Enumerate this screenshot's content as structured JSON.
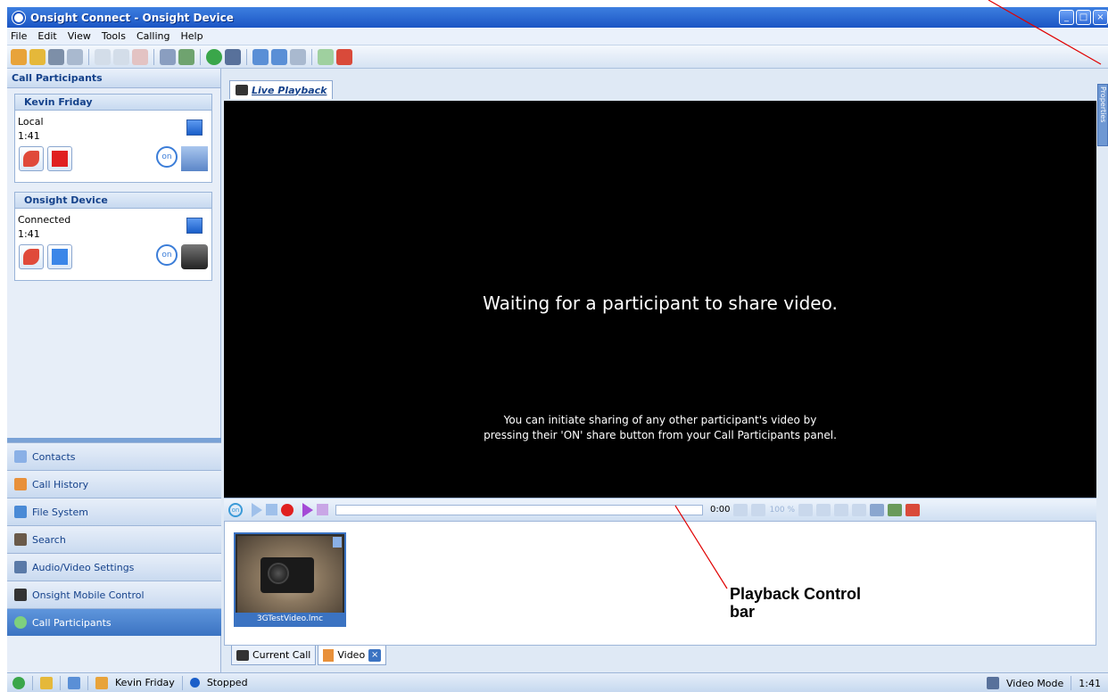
{
  "window": {
    "title": "Onsight Connect - Onsight Device"
  },
  "menu": [
    "File",
    "Edit",
    "View",
    "Tools",
    "Calling",
    "Help"
  ],
  "left_panel": {
    "header": "Call Participants",
    "participants": [
      {
        "name": "Kevin Friday",
        "status": "Local",
        "time": "1:41",
        "share": "on"
      },
      {
        "name": "Onsight Device",
        "status": "Connected",
        "time": "1:41",
        "share": "on"
      }
    ],
    "nav": [
      "Contacts",
      "Call History",
      "File System",
      "Search",
      "Audio/Video Settings",
      "Onsight Mobile Control",
      "Call Participants"
    ]
  },
  "main": {
    "tab": "Live Playback",
    "video_message": "Waiting for a participant to share video.",
    "video_sub_line1": "You can initiate sharing of any other participant's video by",
    "video_sub_line2": "pressing their 'ON' share button from your Call Participants panel.",
    "playback": {
      "time": "0:00",
      "zoom": "100 %",
      "on_label": "on"
    },
    "gallery": [
      {
        "caption": "3GTestVideo.lmc"
      }
    ],
    "bottom_tabs": [
      "Current Call",
      "Video"
    ]
  },
  "right_sidebar": {
    "label": "Properties"
  },
  "annotation": {
    "line1": "Playback Control",
    "line2": "bar"
  },
  "statusbar": {
    "user": "Kevin Friday",
    "state": "Stopped",
    "mode": "Video Mode",
    "time": "1:41"
  }
}
